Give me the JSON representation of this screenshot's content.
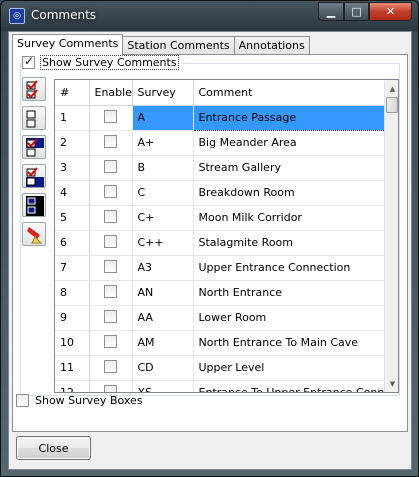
{
  "window": {
    "title": "Comments",
    "app_icon": "cave-app-icon"
  },
  "caption_buttons": {
    "minimize": "▁",
    "maximize": "□",
    "close": "✕"
  },
  "tabs": [
    {
      "label": "Survey Comments",
      "active": true
    },
    {
      "label": "Station Comments",
      "active": false
    },
    {
      "label": "Annotations",
      "active": false
    }
  ],
  "show_survey_comments": {
    "label": "Show Survey Comments",
    "checked": true
  },
  "toolbar_icons": [
    "check-all-icon",
    "uncheck-all-icon",
    "invert-check-icon",
    "check-selected-icon",
    "select-all-icon",
    "erase-icon"
  ],
  "grid": {
    "columns": [
      "#",
      "Enable",
      "Survey",
      "Comment"
    ],
    "rows": [
      {
        "num": "1",
        "enable": false,
        "survey": "A",
        "comment": "Entrance Passage",
        "selected": true
      },
      {
        "num": "2",
        "enable": false,
        "survey": "A+",
        "comment": "Big Meander Area"
      },
      {
        "num": "3",
        "enable": false,
        "survey": "B",
        "comment": "Stream Gallery"
      },
      {
        "num": "4",
        "enable": false,
        "survey": "C",
        "comment": "Breakdown Room"
      },
      {
        "num": "5",
        "enable": false,
        "survey": "C+",
        "comment": "Moon Milk Corridor"
      },
      {
        "num": "6",
        "enable": false,
        "survey": "C++",
        "comment": "Stalagmite Room"
      },
      {
        "num": "7",
        "enable": false,
        "survey": "A3",
        "comment": "Upper Entrance Connection"
      },
      {
        "num": "8",
        "enable": false,
        "survey": "AN",
        "comment": "North Entrance"
      },
      {
        "num": "9",
        "enable": false,
        "survey": "AA",
        "comment": "Lower Room"
      },
      {
        "num": "10",
        "enable": false,
        "survey": "AM",
        "comment": "North Entrance To Main Cave"
      },
      {
        "num": "11",
        "enable": false,
        "survey": "CD",
        "comment": "Upper Level"
      },
      {
        "num": "12",
        "enable": false,
        "survey": "XS",
        "comment": "Entrance To Upper Entrance Connection"
      }
    ]
  },
  "show_survey_boxes": {
    "label": "Show Survey Boxes",
    "checked": false
  },
  "close_button": {
    "label": "Close"
  },
  "colors": {
    "selection": "#3399ff",
    "titlebar": "#2b3840",
    "close_red": "#c2412a"
  }
}
